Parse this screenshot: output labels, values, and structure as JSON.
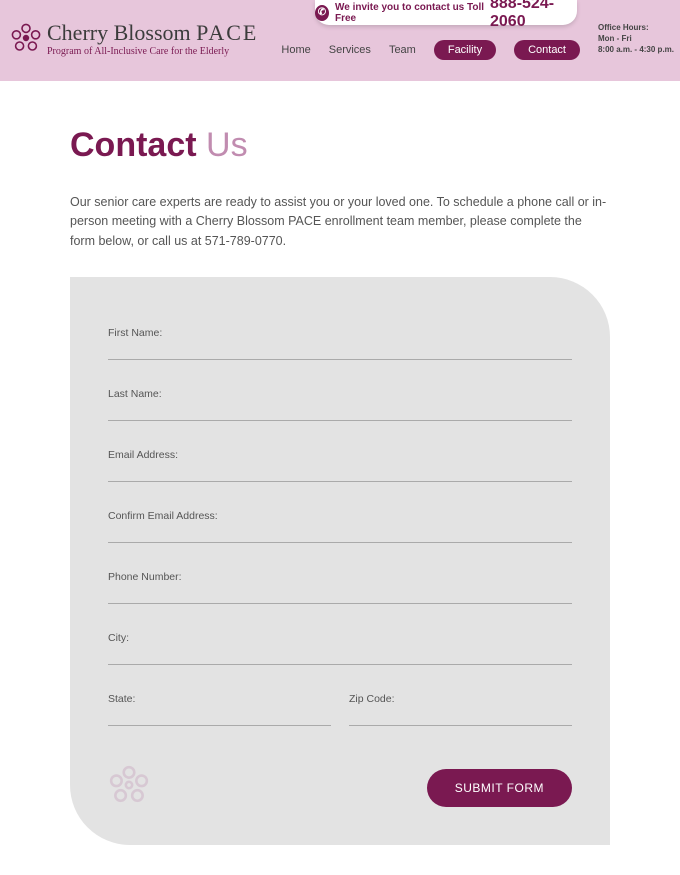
{
  "brand": {
    "name_a": "Cherry Blossom ",
    "name_b": "PACE",
    "tagline": "Program of All-Inclusive Care for the Elderly"
  },
  "tollfree": {
    "invite": "We invite you to contact us Toll Free",
    "number": "888-524-2060"
  },
  "hours": {
    "label": "Office Hours:",
    "days": "Mon - Fri",
    "time": "8:00 a.m. - 4:30 p.m."
  },
  "nav": {
    "home": "Home",
    "services": "Services",
    "team": "Team",
    "facility": "Facility",
    "contact": "Contact"
  },
  "page": {
    "title_a": "Contact",
    "title_b": " Us",
    "intro": "Our senior care experts are ready to assist you or your loved one. To schedule a phone call or in-person meeting with a Cherry Blossom PACE enrollment team member, please complete the form below, or call us at 571-789-0770."
  },
  "form": {
    "first_name": "First Name:",
    "last_name": "Last Name:",
    "email": "Email Address:",
    "confirm_email": "Confirm Email Address:",
    "phone": "Phone Number:",
    "city": "City:",
    "state": "State:",
    "zip": "Zip Code:",
    "submit": "SUBMIT FORM",
    "values": {
      "first_name": "",
      "last_name": "",
      "email": "",
      "confirm_email": "",
      "phone": "",
      "city": "",
      "state": "",
      "zip": ""
    }
  },
  "colors": {
    "brand": "#7a1951",
    "band": "#e7c6db",
    "card": "#e3e3e3"
  }
}
